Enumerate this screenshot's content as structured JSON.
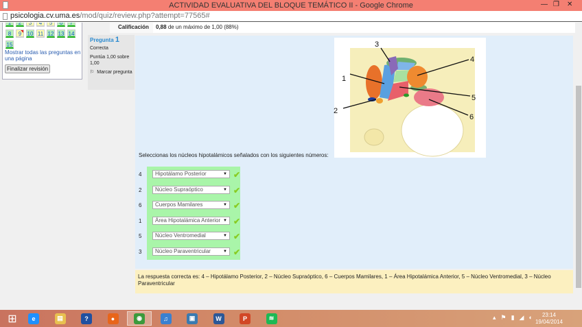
{
  "window": {
    "title": "ACTIVIDAD EVALUATIVA DEL BLOQUE TEMÁTICO II - Google Chrome",
    "url_host": "psicologia.cv.uma.es",
    "url_path": "/mod/quiz/review.php?attempt=77565#"
  },
  "nav": {
    "questions": [
      {
        "n": "1",
        "s": "g"
      },
      {
        "n": "2",
        "s": "g"
      },
      {
        "n": "3",
        "s": "y"
      },
      {
        "n": "4",
        "s": "y"
      },
      {
        "n": "5",
        "s": "y"
      },
      {
        "n": "6",
        "s": "g"
      },
      {
        "n": "7",
        "s": "g"
      },
      {
        "n": "8",
        "s": "g"
      },
      {
        "n": "9",
        "s": "y"
      },
      {
        "n": "10",
        "s": "g"
      },
      {
        "n": "11",
        "s": "y"
      },
      {
        "n": "12",
        "s": "g"
      },
      {
        "n": "13",
        "s": "g"
      },
      {
        "n": "14",
        "s": "g"
      },
      {
        "n": "15",
        "s": "g"
      }
    ],
    "show_all": "Mostrar todas las preguntas en una página",
    "finish": "Finalizar revisión"
  },
  "grade": {
    "label": "Calificación",
    "value_bold": "0,88",
    "value_rest": "de un máximo de 1,00 (88%)"
  },
  "info": {
    "pregunta": "Pregunta",
    "num": "1",
    "state": "Correcta",
    "score": "Puntúa 1,00 sobre 1,00",
    "flag": "Marcar pregunta"
  },
  "diagram_labels": [
    "1",
    "2",
    "3",
    "4",
    "5",
    "6"
  ],
  "question": {
    "prompt": "Seleccionas los núcleos hipotalámicos señalados con los siguientes números:",
    "rows": [
      {
        "num": "4",
        "value": "Hipotálamo Posterior"
      },
      {
        "num": "2",
        "value": "Núcleo Supraóptico"
      },
      {
        "num": "6",
        "value": "Cuerpos Mamilares"
      },
      {
        "num": "1",
        "value": "Área Hipotalámica Anterior"
      },
      {
        "num": "5",
        "value": "Núcleo Ventromedial"
      },
      {
        "num": "3",
        "value": "Núcleo Paraventricular"
      }
    ]
  },
  "feedback": "La respuesta correcta es: 4 – Hipotálamo Posterior, 2 – Núcleo Supraóptico, 6 – Cuerpos Mamilares, 1 – Área Hipotalámica Anterior, 5 – Núcleo Ventromedial, 3 – Núcleo Paraventricular",
  "taskbar": {
    "apps": [
      "start",
      "internet-explorer",
      "file-explorer",
      "help",
      "firefox",
      "chrome",
      "itunes",
      "remote-desktop",
      "word",
      "powerpoint",
      "spotify"
    ],
    "time": "23:14",
    "date": "19/04/2014"
  },
  "colors": {
    "title": "#f47f72",
    "correct": "#a9f5a9",
    "question_bg": "#e1eefa",
    "feedback_bg": "#fcf0c0"
  }
}
